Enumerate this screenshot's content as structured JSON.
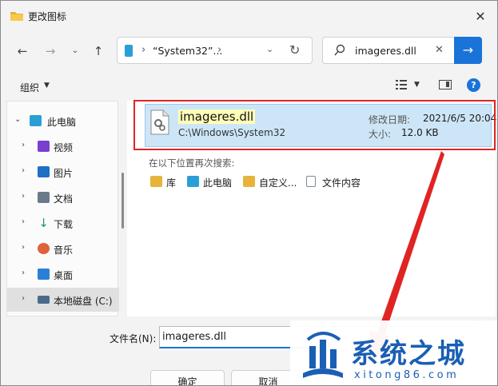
{
  "window": {
    "title": "更改图标"
  },
  "address": {
    "path": "“System32”..."
  },
  "search": {
    "value": "imageres.dll"
  },
  "toolbar": {
    "organize_label": "组织",
    "help_label": "?"
  },
  "sidebar": {
    "items": [
      {
        "label": "此电脑",
        "icon": "monitor-icon",
        "expanded": true,
        "color": "#2a9fd6"
      },
      {
        "label": "视频",
        "icon": "video-icon",
        "color": "#7a3fd0"
      },
      {
        "label": "图片",
        "icon": "picture-icon",
        "color": "#1f6fc7"
      },
      {
        "label": "文档",
        "icon": "document-icon",
        "color": "#6b7a8a"
      },
      {
        "label": "下载",
        "icon": "download-icon",
        "color": "#1e9e5a"
      },
      {
        "label": "音乐",
        "icon": "music-icon",
        "color": "#e0623a"
      },
      {
        "label": "桌面",
        "icon": "desktop-icon",
        "color": "#2a7fd6"
      },
      {
        "label": "本地磁盘 (C:)",
        "icon": "drive-icon",
        "color": "#4a6a8a",
        "selected": true
      }
    ]
  },
  "file": {
    "name": "imageres.dll",
    "path": "C:\\Windows\\System32",
    "modified_label": "修改日期:",
    "modified_value": "2021/6/5 20:04",
    "size_label": "大小:",
    "size_value": "12.0 KB"
  },
  "search_again": {
    "label": "在以下位置再次搜索:",
    "locations": [
      {
        "label": "库",
        "icon": "library-icon",
        "color": "#e8b33a"
      },
      {
        "label": "此电脑",
        "icon": "monitor-icon",
        "color": "#2a9fd6"
      },
      {
        "label": "自定义...",
        "icon": "folder-icon",
        "color": "#e8b33a"
      },
      {
        "label": "文件内容",
        "icon": "file-content-icon",
        "color": "#7a8a9a"
      }
    ]
  },
  "bottom": {
    "filename_label": "文件名(N):",
    "filename_value": "imageres.dll",
    "ok_label": "确定",
    "cancel_label": "取消"
  },
  "watermark": {
    "title": "系统之城",
    "subtitle": "xitong86.com"
  },
  "colors": {
    "accent": "#1a73d9",
    "highlight": "#e02424",
    "selection": "#cde6f7"
  }
}
